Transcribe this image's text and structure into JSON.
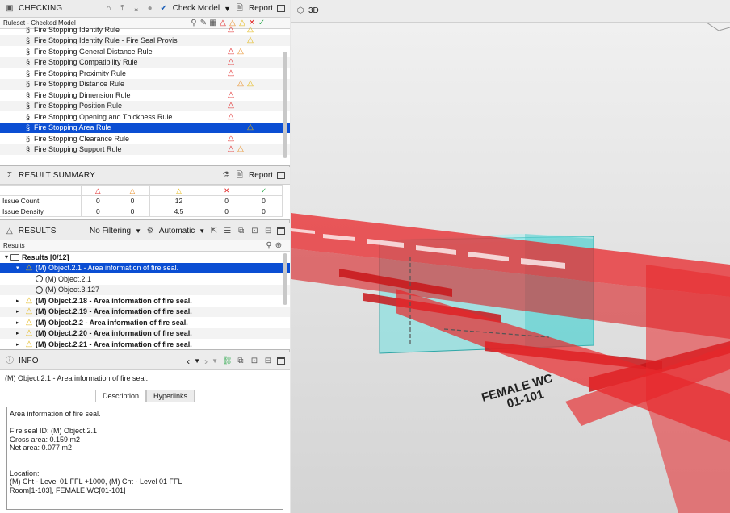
{
  "checking": {
    "title": "CHECKING",
    "check_model": "Check Model",
    "report": "Report",
    "column_label": "Ruleset - Checked Model",
    "rules": [
      {
        "label": "Fire Stopping Identity Rule",
        "r": true,
        "o": false,
        "y": true
      },
      {
        "label": "Fire Stopping Identity Rule - Fire Seal Provis",
        "r": false,
        "o": false,
        "y": true
      },
      {
        "label": "Fire Stopping General Distance Rule",
        "r": true,
        "o": true,
        "y": false
      },
      {
        "label": "Fire Stopping Compatibility Rule",
        "r": true,
        "o": false,
        "y": false
      },
      {
        "label": "Fire Stopping Proximity Rule",
        "r": true,
        "o": false,
        "y": false
      },
      {
        "label": "Fire Stopping Distance Rule",
        "r": false,
        "o": true,
        "y": true
      },
      {
        "label": "Fire Stopping Dimension Rule",
        "r": true,
        "o": false,
        "y": false
      },
      {
        "label": "Fire Stopping Position Rule",
        "r": true,
        "o": false,
        "y": false
      },
      {
        "label": "Fire Stopping Opening and Thickness Rule",
        "r": true,
        "o": false,
        "y": false
      },
      {
        "label": "Fire Stopping Area Rule",
        "r": false,
        "o": false,
        "y": true,
        "selected": true
      },
      {
        "label": "Fire Stopping Clearance Rule",
        "r": true,
        "o": false,
        "y": false
      },
      {
        "label": "Fire Stopping Support Rule",
        "r": true,
        "o": true,
        "y": false
      }
    ],
    "rule_symbol": "§"
  },
  "summary": {
    "title": "RESULT SUMMARY",
    "report": "Report",
    "rows": [
      {
        "label": "Issue Count",
        "values": [
          "0",
          "0",
          "12",
          "0",
          "0"
        ]
      },
      {
        "label": "Issue Density",
        "values": [
          "0",
          "0",
          "4.5",
          "0",
          "0"
        ]
      }
    ]
  },
  "results": {
    "title": "RESULTS",
    "filter": "No Filtering",
    "mode": "Automatic",
    "column_label": "Results",
    "root": "Results [0/12]",
    "items": [
      {
        "label": "(M) Object.2.1 - Area information of fire seal.",
        "level": 1,
        "kind": "tri",
        "expand": "▾",
        "selected": true
      },
      {
        "label": "(M) Object.2.1",
        "level": 2,
        "kind": "circle"
      },
      {
        "label": "(M) Object.3.127",
        "level": 2,
        "kind": "circle"
      },
      {
        "label": "(M) Object.2.18 - Area information of fire seal.",
        "level": 1,
        "kind": "tri",
        "expand": "▸",
        "bold": true
      },
      {
        "label": "(M) Object.2.19 - Area information of fire seal.",
        "level": 1,
        "kind": "tri",
        "expand": "▸",
        "bold": true
      },
      {
        "label": "(M) Object.2.2 - Area information of fire seal.",
        "level": 1,
        "kind": "tri",
        "expand": "▸",
        "bold": true
      },
      {
        "label": "(M) Object.2.20 - Area information of fire seal.",
        "level": 1,
        "kind": "tri",
        "expand": "▸",
        "bold": true
      },
      {
        "label": "(M) Object.2.21 - Area information of fire seal.",
        "level": 1,
        "kind": "tri",
        "expand": "▸",
        "bold": true
      }
    ]
  },
  "info": {
    "title": "INFO",
    "heading": "(M) Object.2.1 - Area information of fire seal.",
    "tab_description": "Description",
    "tab_hyperlinks": "Hyperlinks",
    "lines": [
      "Area information of fire seal.",
      "",
      "Fire seal ID: (M) Object.2.1",
      "Gross area: 0.159 m2",
      "Net area: 0.077 m2",
      "",
      "",
      "Location:",
      "(M) Cht - Level 01 FFL +1000, (M) Cht - Level 01 FFL",
      "Room[1-103], FEMALE WC[01-101]"
    ]
  },
  "view3d": {
    "title": "3D",
    "room_label_1": "FEMALE WC",
    "room_label_2": "01-101"
  },
  "colors": {
    "selection": "#0b4ed3",
    "critical": "#e02424",
    "moderate": "#e8912c",
    "low": "#e3b614",
    "ok": "#2aa84a",
    "duct": "#e8262a",
    "seal": "#6fe0e0"
  }
}
